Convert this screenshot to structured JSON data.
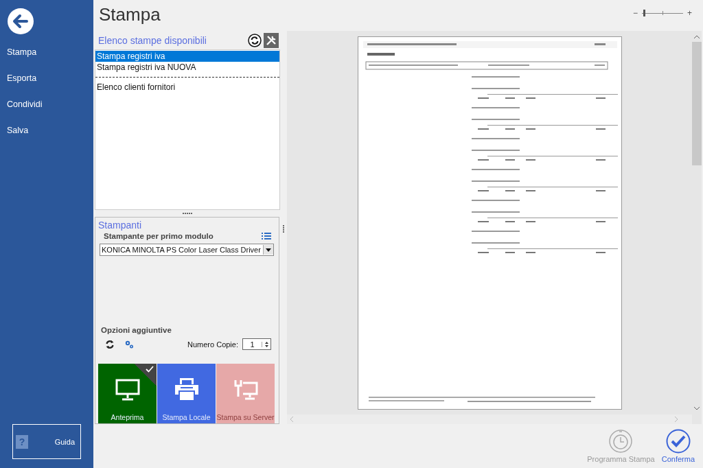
{
  "sidebar": {
    "items": [
      {
        "label": "Stampa",
        "selected": false
      },
      {
        "label": "Esporta",
        "selected": false
      },
      {
        "label": "Condividi",
        "selected": false
      },
      {
        "label": "Salva",
        "selected": false
      }
    ],
    "help": {
      "icon": "?",
      "label": "Guida"
    }
  },
  "title": "Stampa",
  "zoom": {
    "minus": "−",
    "plus": "+",
    "level": 0.03
  },
  "reports": {
    "heading": "Elenco stampe disponibili",
    "items": [
      {
        "kind": "entry",
        "label": "Stampa registri iva",
        "selected": true
      },
      {
        "kind": "entry",
        "label": "Stampa registri iva NUOVA",
        "selected": false
      },
      {
        "kind": "separator"
      },
      {
        "kind": "entry",
        "label": "Elenco clienti fornitori",
        "selected": false
      }
    ]
  },
  "printers": {
    "heading": "Stampanti",
    "label": "Stampante per primo modulo",
    "value": "KONICA MINOLTA PS Color Laser Class Driver",
    "options_heading": "Opzioni aggiuntive",
    "copies_label": "Numero Copie:",
    "copies": "1"
  },
  "modes": [
    {
      "kind": "monitor",
      "label": "Anteprima",
      "color": "#006400",
      "selected": true,
      "disabled": false
    },
    {
      "kind": "printer",
      "label": "Stampa Locale",
      "color": "#4169e1",
      "selected": false,
      "disabled": false
    },
    {
      "kind": "server",
      "label": "Stampa su Server",
      "color": "#e6a8a8",
      "selected": false,
      "disabled": true
    }
  ],
  "actions": [
    {
      "kind": "clock",
      "label": "Programma Stampa",
      "disabled": true
    },
    {
      "kind": "check",
      "label": "Conferma",
      "disabled": false
    }
  ]
}
